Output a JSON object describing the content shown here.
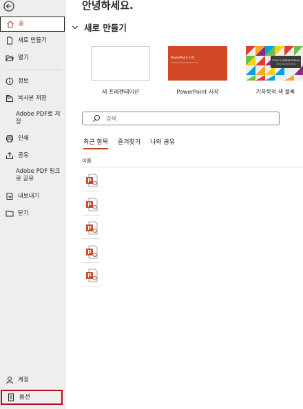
{
  "sidebar": {
    "back_icon": "back-arrow-icon",
    "items": [
      {
        "label": "홈",
        "icon": "home-icon"
      },
      {
        "label": "새로 만들기",
        "icon": "new-document-icon"
      },
      {
        "label": "열기",
        "icon": "folder-open-icon"
      },
      {
        "label": "정보",
        "icon": "info-icon"
      },
      {
        "label": "복사본 저장",
        "icon": "save-copy-icon"
      },
      {
        "label": "Adobe PDF로 저장",
        "icon": ""
      },
      {
        "label": "인쇄",
        "icon": "printer-icon"
      },
      {
        "label": "공유",
        "icon": "share-icon"
      },
      {
        "label": "Adobe PDF 링크로 공유",
        "icon": ""
      },
      {
        "label": "내보내기",
        "icon": "export-icon"
      },
      {
        "label": "닫기",
        "icon": "close-folder-icon"
      },
      {
        "label": "계정",
        "icon": "account-icon"
      },
      {
        "label": "옵션",
        "icon": "options-icon"
      }
    ]
  },
  "main": {
    "greeting": "안녕하세요.",
    "new_section_title": "새로 만들기",
    "templates": [
      {
        "label": "새 프레젠테이션"
      },
      {
        "label": "PowerPoint 시작",
        "thumb_title": "PowerPoint 시작"
      },
      {
        "label": "기하학적 색 블록",
        "thumb_title": "TITLE LOREM IPSUM"
      }
    ],
    "search_placeholder": "검색",
    "tabs": [
      "최근 항목",
      "즐겨찾기",
      "나와 공유"
    ],
    "column_header": "이름",
    "recent_files_count": 5
  },
  "colors": {
    "accent": "#b7472a",
    "ppt_orange": "#d24726",
    "sidebar_bg": "#f0eeec",
    "options_highlight": "#b10f1f"
  }
}
